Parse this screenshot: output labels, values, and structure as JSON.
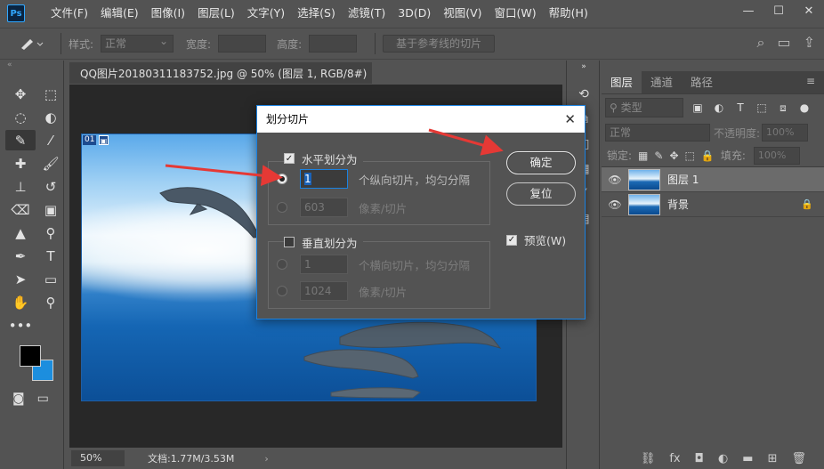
{
  "app": {
    "logo": "Ps",
    "menu": [
      "文件(F)",
      "编辑(E)",
      "图像(I)",
      "图层(L)",
      "文字(Y)",
      "选择(S)",
      "滤镜(T)",
      "3D(D)",
      "视图(V)",
      "窗口(W)",
      "帮助(H)"
    ]
  },
  "options": {
    "style_label": "样式:",
    "style_value": "正常",
    "width_label": "宽度:",
    "height_label": "高度:",
    "guides_button": "基于参考线的切片"
  },
  "document": {
    "tab_title": "QQ图片20180311183752.jpg @ 50% (图层 1, RGB/8#) *",
    "slice_badge": "01",
    "zoom": "50%",
    "doc_info": "文档:1.77M/3.53M"
  },
  "layers_panel": {
    "tabs": [
      "图层",
      "通道",
      "路径"
    ],
    "filter_kind": "类型",
    "blend_mode": "正常",
    "opacity_label": "不透明度:",
    "opacity_value": "100%",
    "lock_label": "锁定:",
    "fill_label": "填充:",
    "fill_value": "100%",
    "layers": [
      {
        "name": "图层 1",
        "selected": true
      },
      {
        "name": "背景",
        "locked": true
      }
    ]
  },
  "dialog": {
    "title": "划分切片",
    "horizontal": {
      "label": "水平划分为",
      "checked": true,
      "option1_value": "1",
      "option1_label": "个纵向切片，均匀分隔",
      "option2_value": "603",
      "option2_label": "像素/切片"
    },
    "vertical": {
      "label": "垂直划分为",
      "checked": false,
      "option1_value": "1",
      "option1_label": "个横向切片，均匀分隔",
      "option2_value": "1024",
      "option2_label": "像素/切片"
    },
    "ok_button": "确定",
    "reset_button": "复位",
    "preview_label": "预览(W)",
    "preview_checked": true
  },
  "colors": {
    "accent": "#1a82e2",
    "foreground": "#000000",
    "background": "#1c8ede",
    "arrow": "#e53935"
  }
}
